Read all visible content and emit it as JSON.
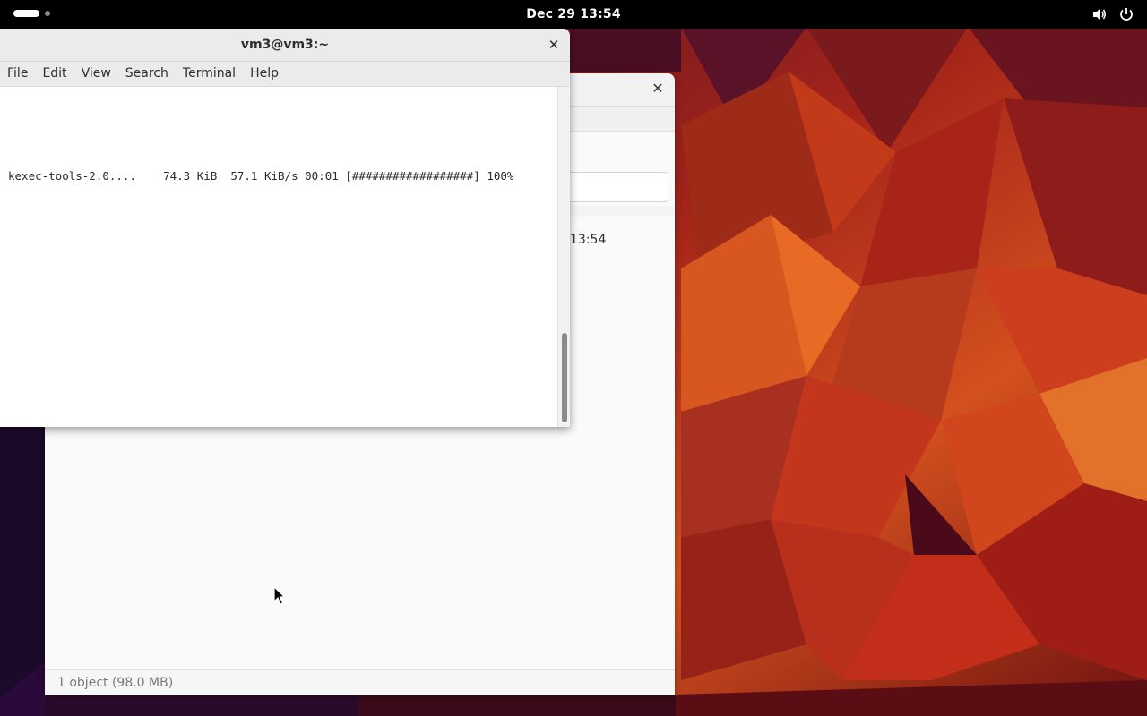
{
  "topbar": {
    "clock": "Dec 29  13:54",
    "icons": [
      "volume-icon",
      "power-icon"
    ]
  },
  "terminal": {
    "title": "vm3@vm3:~",
    "menu": [
      "File",
      "Edit",
      "View",
      "Search",
      "Terminal",
      "Help"
    ],
    "line": "kexec-tools-2.0....    74.3 KiB  57.1 KiB/s 00:01 [##################] 100%"
  },
  "background_window": {
    "time": "13:54",
    "status": "1 object (98.0 MB)"
  },
  "colors": {
    "topbar": "#000000",
    "wallpaper_accent": "#c0301c"
  }
}
